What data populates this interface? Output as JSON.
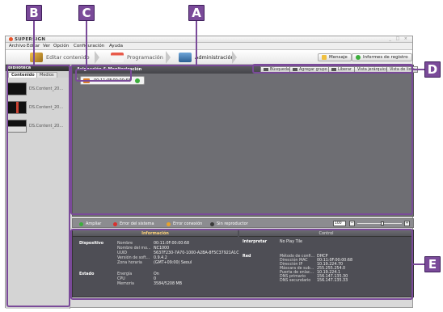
{
  "markers": {
    "a": "A",
    "b": "B",
    "c": "C",
    "d": "D",
    "e": "E"
  },
  "window": {
    "brand": "SUPERSIGN",
    "controls": "_ □ ×"
  },
  "menu": [
    "Archivo",
    "Editar",
    "Ver",
    "Opción",
    "Configuración",
    "Ayuda"
  ],
  "steps": [
    {
      "label": "Editar contenido"
    },
    {
      "label": "Programación"
    },
    {
      "label": "Administración"
    }
  ],
  "top_buttons": {
    "message": "Mensaje",
    "registry": "Informes de registro"
  },
  "library": {
    "title": "Biblioteca",
    "tabs": [
      "Contenido",
      "Medios"
    ],
    "items": [
      {
        "name": "DS.Content_20..."
      },
      {
        "name": "DS.Content_20..."
      },
      {
        "name": "DS.Content_20..."
      }
    ]
  },
  "main": {
    "title": "Asignación & Monitorización",
    "buttons": [
      "Búsqueda",
      "Agregar grupo",
      "Liberar",
      "Vista jerárquica",
      "Vista de lista"
    ],
    "device": {
      "prefix": "+",
      "name": "00:11:0F:00:00:68"
    }
  },
  "statusbar": {
    "legend": [
      "Ampliar",
      "Error del sistema",
      "Error conexión",
      "Sin reproductor"
    ],
    "zoom": "100",
    "minus": "−",
    "plus": "+"
  },
  "info": {
    "title": "Información",
    "control_title": "Control",
    "device_label": "Dispositivo",
    "device_keys": [
      "Nombre",
      "Nombre del mo...",
      "UUID",
      "Versión de soft...",
      "Zona horaria"
    ],
    "device_vals": [
      "00:11:0F:00:00:68",
      "NC1000",
      "5637F230-7A70-1000-A2BA-8F5C37921A1C",
      "0.9.4.2",
      "(GMT+09:00) Seoul"
    ],
    "state_label": "Estado",
    "state_keys": [
      "Energía",
      "CPU",
      "Memoria"
    ],
    "state_vals": [
      "On",
      "0",
      "3584/5208 MB"
    ],
    "interpreter_label": "Interpretar",
    "interpreter_val": "No Play Tile",
    "net_label": "Red",
    "net_keys": [
      "Método de confi...",
      "Dirección MAC",
      "Dirección IP",
      "Máscara de sub...",
      "Puerta de enlac...",
      "DNS primario",
      "DNS secundario"
    ],
    "net_vals": [
      "DHCP",
      "00:11:0F:00:00:68",
      "10.19.224.70",
      "255.255.254.0",
      "10.19.224.1",
      "156.147.135.30",
      "156.147.135.33"
    ]
  },
  "colors": {
    "marker": "#7a4a99",
    "ok": "#3cae3c",
    "error": "#d9302f",
    "warn": "#e8a22b"
  }
}
